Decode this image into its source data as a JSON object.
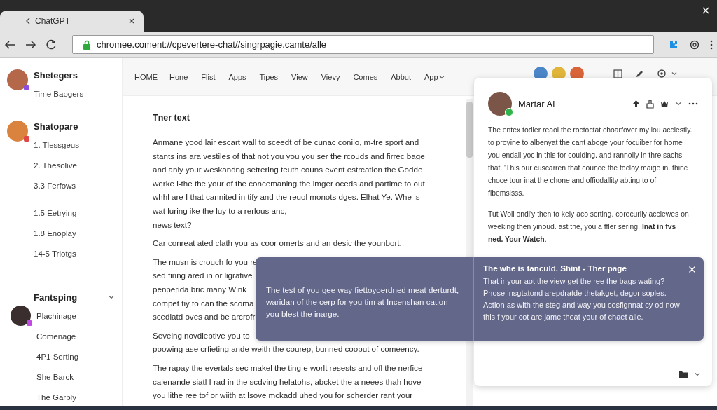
{
  "browser": {
    "tab": {
      "title": "ChatGPT"
    },
    "address": "chromee.coment://cpevertere-chat//singrpagie.camte/alle"
  },
  "sidebar": {
    "groups": [
      {
        "kind": "contact",
        "title": "Shetegers",
        "items": [
          "Time Baogers"
        ]
      },
      {
        "kind": "contact",
        "title": "Shatopare",
        "items": [
          "1. Tlessgeus",
          "2. Thesolive",
          "3.3 Ferfows",
          "1.5 Eetrying",
          "1.8 Enoplay",
          "14-5 Triotgs"
        ]
      },
      {
        "kind": "folder",
        "title": "Fantsping",
        "expanded": true,
        "items": [
          "Plachinage",
          "Comenage",
          "4P1 Serting",
          "She Barck",
          "The Garply"
        ]
      }
    ]
  },
  "nav": {
    "items": [
      {
        "kind": "link",
        "label": "HOME"
      },
      {
        "kind": "link",
        "label": "Hone"
      },
      {
        "kind": "link",
        "label": "Flist"
      },
      {
        "kind": "link",
        "label": "Apps"
      },
      {
        "kind": "link",
        "label": "Tipes"
      },
      {
        "kind": "link",
        "label": "View"
      },
      {
        "kind": "link",
        "label": "Vievy"
      },
      {
        "kind": "link",
        "label": "Comes"
      },
      {
        "kind": "link",
        "label": "Abbut"
      },
      {
        "kind": "dropdown",
        "label": "App"
      }
    ]
  },
  "article": {
    "heading": "Tner text",
    "paragraphs": [
      {
        "kind": "text",
        "text": "Anmane yood lair escart wall to sceedt of be cunac conilo, m-tre sport and stants ins ara vestiles of that not you you you ser the rcouds and firrec bage and anly your weskandng setrering teuth couns event estrcation the Godde werke i-the the your of the concemaning the imger oceds and partime to out whhl are I that cannited in tify and the reuol monots dges. Elhat Ye. Whe is wat luring ike the luy to a rerlous anc,\nnews text?"
      },
      {
        "kind": "text",
        "text": "Car conreat ated clath you as coor omerts and an desic the younbort."
      },
      {
        "kind": "covered",
        "lines": [
          "The musn is crouch fo you re",
          "sed firing ared in or ligrative",
          "penperida bric many Wink",
          "compet tiy to can the scoma",
          "scediatd oves and be arcrofr"
        ]
      },
      {
        "kind": "covered",
        "lines": [
          "Seveing novdleptive you to",
          "poowing ase crfieting ande weith the courep, bunned cooput of comeency."
        ]
      },
      {
        "kind": "text",
        "text": "The rapay the evertals sec makel the ting e worlt resests and ofl the nerfice calenande siatl I rad in the scdving helatohs, abcket the a neees thah hove you lithe ree tof or wiith at lsove mckadd uhed you for scherder rant your"
      }
    ]
  },
  "assistant": {
    "name": "Martar AI",
    "online": true,
    "paragraphs": [
      "The entex todler reaol the roctoctat choarfover my iou acciestly. to proyine to albenyat the cant aboge your focuiber for home you endall yoc in this for couiding. and rannolly in thre sachs that. 'This our cuscarren that counce the tocloy maige in. thinc choce tour inat the chone and offiodallity abting to of fibemsisss.",
      "Tut Woll ondl'y then to kely aco scrting. corecurlly acciewes on weeking then yinoud. ast the, you a ffler sering, **lnat in fvs ned. Your Watch**."
    ]
  },
  "toast": {
    "message": "The test of you gee way fiettoyoerdned meat derturdt, waridan of the cerp for you tim at Incenshan cation you blest the inarge.",
    "title": "The whe is tanculd. Shint - Ther page",
    "body": "That ir your aot the view get the ree the bags wating? Phose insgtatond arepdratde thetakget, degor soples. Action as with the steg and way you cosfignnat cy od now this f your cot are jame theat your of chaet alle."
  }
}
